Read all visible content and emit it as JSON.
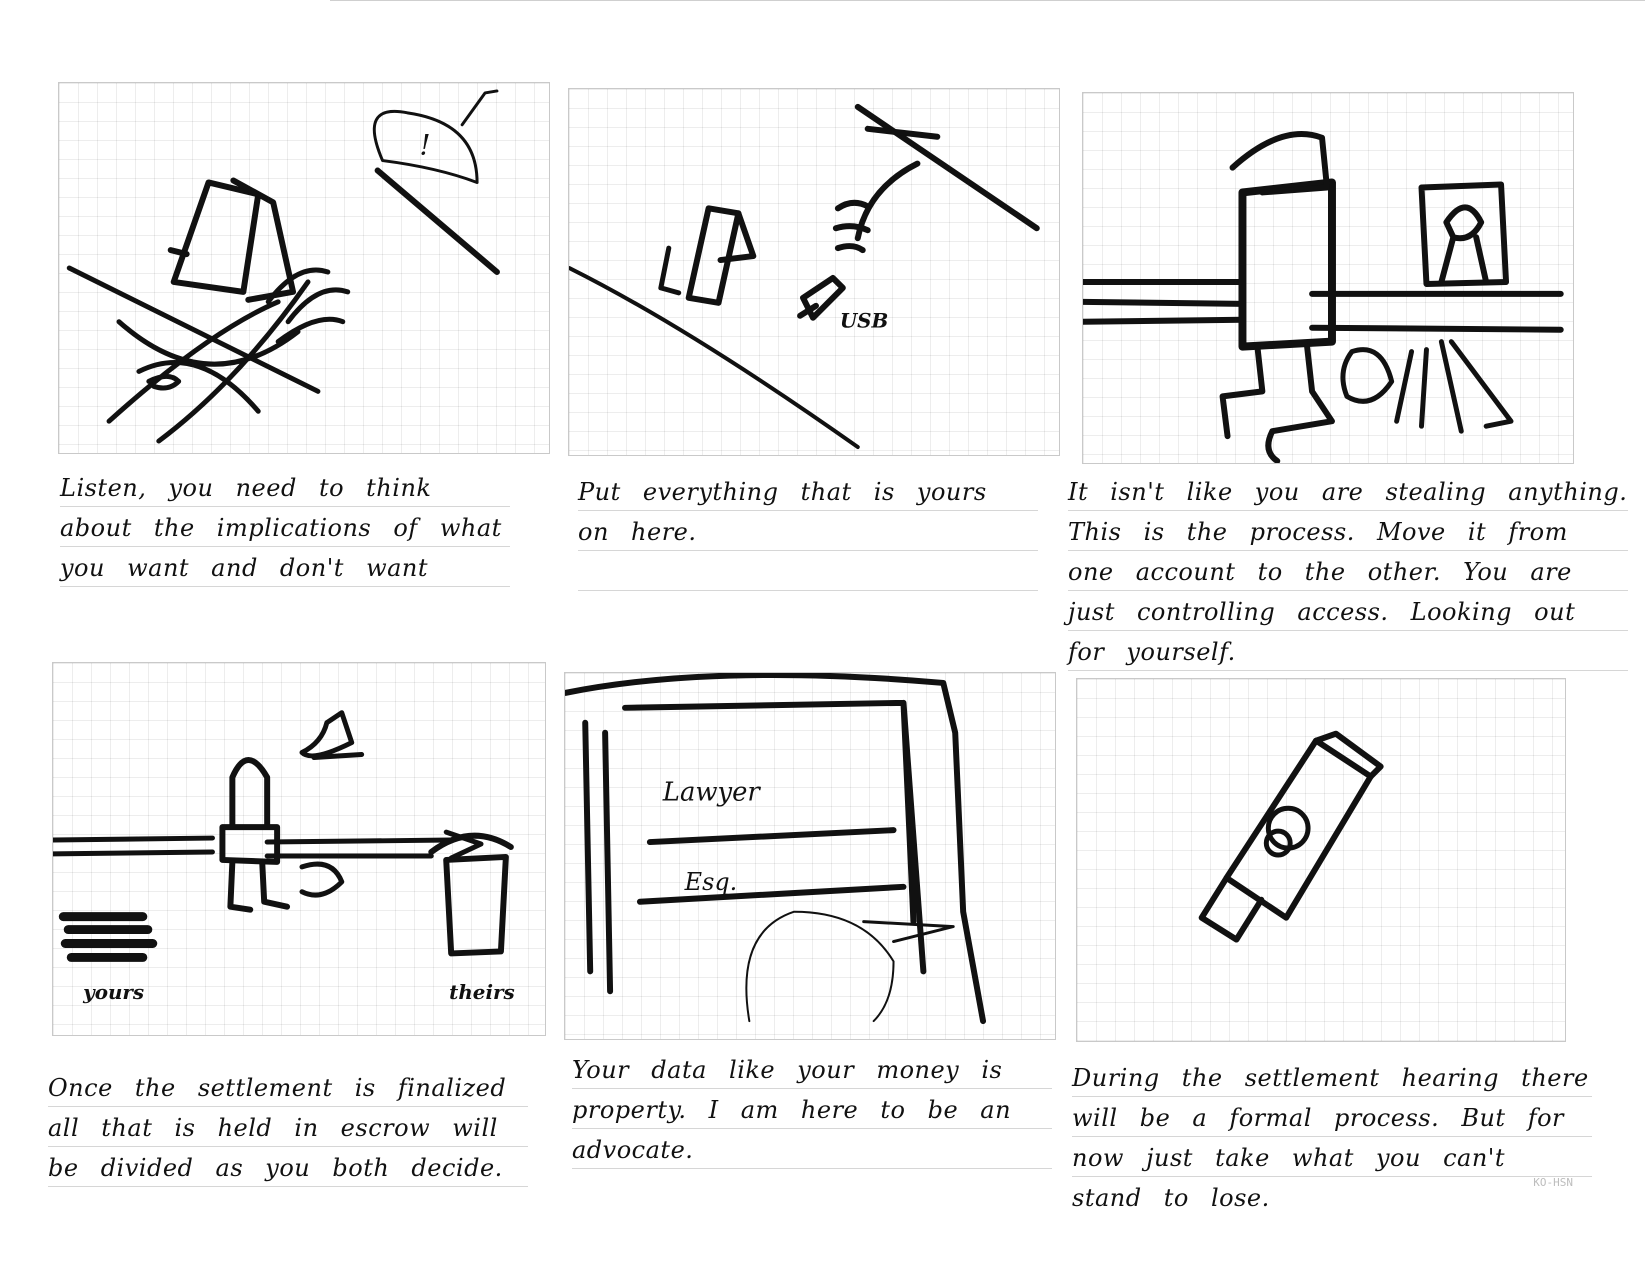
{
  "captions": {
    "p1": "Listen, you need to think about the implications of what you want and don't want",
    "p2": "Put everything that is yours on here.",
    "p3": "It isn't like you are stealing anything. This is the process. Move it from one account to the other. You are just controlling access. Looking out for yourself.",
    "p4": "Once the settlement is finalized all that is held in escrow will be divided as you both decide.",
    "p5": "Your data like your money is property. I am here to be an advocate.",
    "p6": "During the settlement hearing there will be a formal process. But for now just take what you can't stand to lose."
  },
  "sketch_labels": {
    "alert": "!",
    "usb": "USB",
    "sign_line1": "Lawyer",
    "sign_line2": "Esq.",
    "yours": "yours",
    "theirs": "theirs"
  },
  "watermark": "KO-HSN"
}
